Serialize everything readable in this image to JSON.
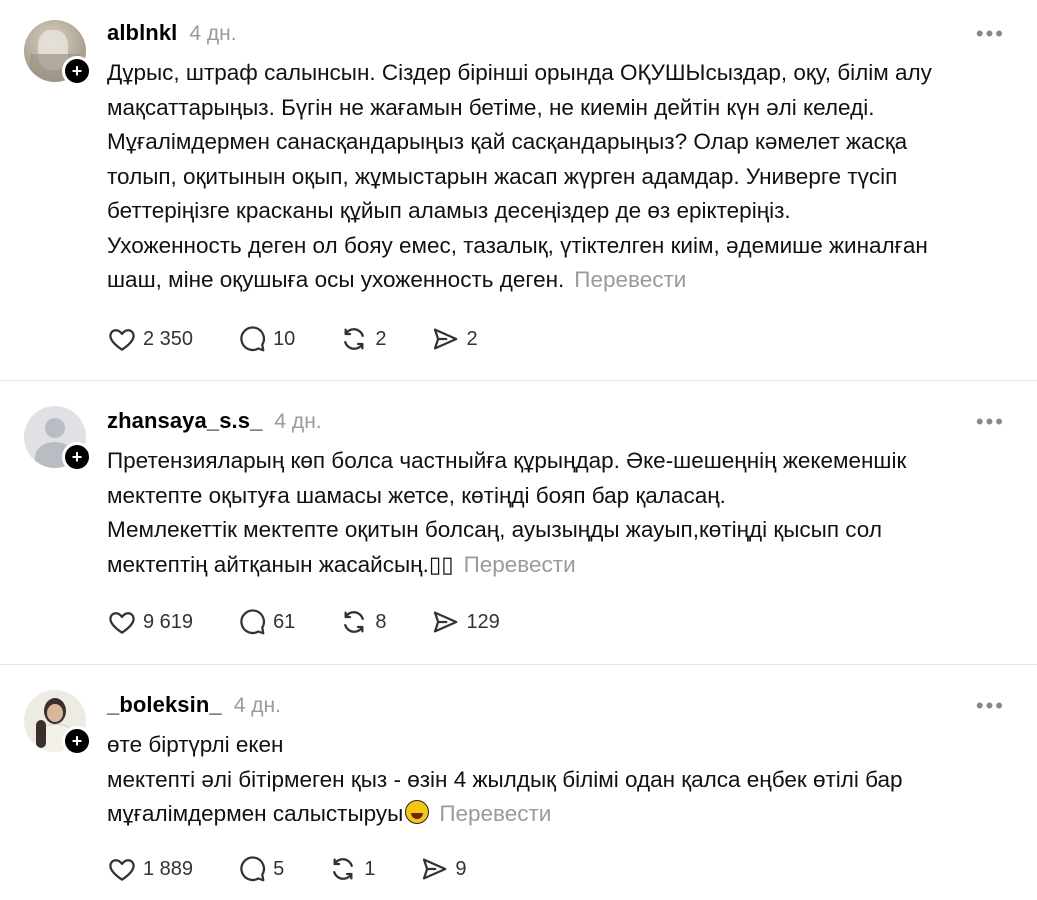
{
  "posts": [
    {
      "username": "alblnkl",
      "ago": "4 дн.",
      "lines": [
        "Дұрыс, штраф салынсын. Сіздер бірінші орында ОҚУШЫсыздар, оқу, білім алу",
        "мақсаттарыңыз. Бүгін не жағамын бетіме, не киемін дейтін күн әлі келеді.",
        "Мұғалімдермен санасқандарыңыз қай сасқандарыңыз? Олар кәмелет жасқа",
        "толып, оқитынын оқып, жұмыстарын жасап жүрген адамдар. Универге түсіп",
        "беттеріңізге красканы құйып аламыз десеңіздер де өз еріктеріңіз.",
        "Ухоженность деген ол бояу емес, тазалық, үтіктелген киім, әдемише жиналған",
        "шаш, міне оқушыға осы ухоженность деген."
      ],
      "translate": "Перевести",
      "likes": "2 350",
      "replies": "10",
      "reposts": "2",
      "shares": "2"
    },
    {
      "username": "zhansaya_s.s_",
      "ago": "4 дн.",
      "lines": [
        "Претензияларың көп болса частныйға құрыңдар. Әке-шешеңнің жекеменшік",
        "мектепте оқытуға шамасы жетсе, көтіңді бояп бар қаласаң.",
        "Мемлекеттік мектепте оқитын болсаң, ауызыңды жауып,көтіңді қысып сол",
        "мектептің айтқанын жасайсың.▯▯"
      ],
      "translate": "Перевести",
      "likes": "9 619",
      "replies": "61",
      "reposts": "8",
      "shares": "129"
    },
    {
      "username": "_boleksin_",
      "ago": "4 дн.",
      "lines": [
        "өте біртүрлі екен",
        "мектепті әлі бітірмеген қыз - өзін 4 жылдық білімі одан қалса еңбек өтілі бар",
        "мұғалімдермен салыстыруы"
      ],
      "translate": "Перевести",
      "likes": "1 889",
      "replies": "5",
      "reposts": "1",
      "shares": "9"
    }
  ],
  "icons": {
    "follow": "plus-icon",
    "more": "more-dots-icon",
    "like": "heart-icon",
    "reply": "comment-icon",
    "repost": "repost-icon",
    "share": "send-icon",
    "emoji": "rolling-laughing-emoji"
  },
  "colors": {
    "muted": "#9a9a9a",
    "divider": "#e3e3e3"
  }
}
